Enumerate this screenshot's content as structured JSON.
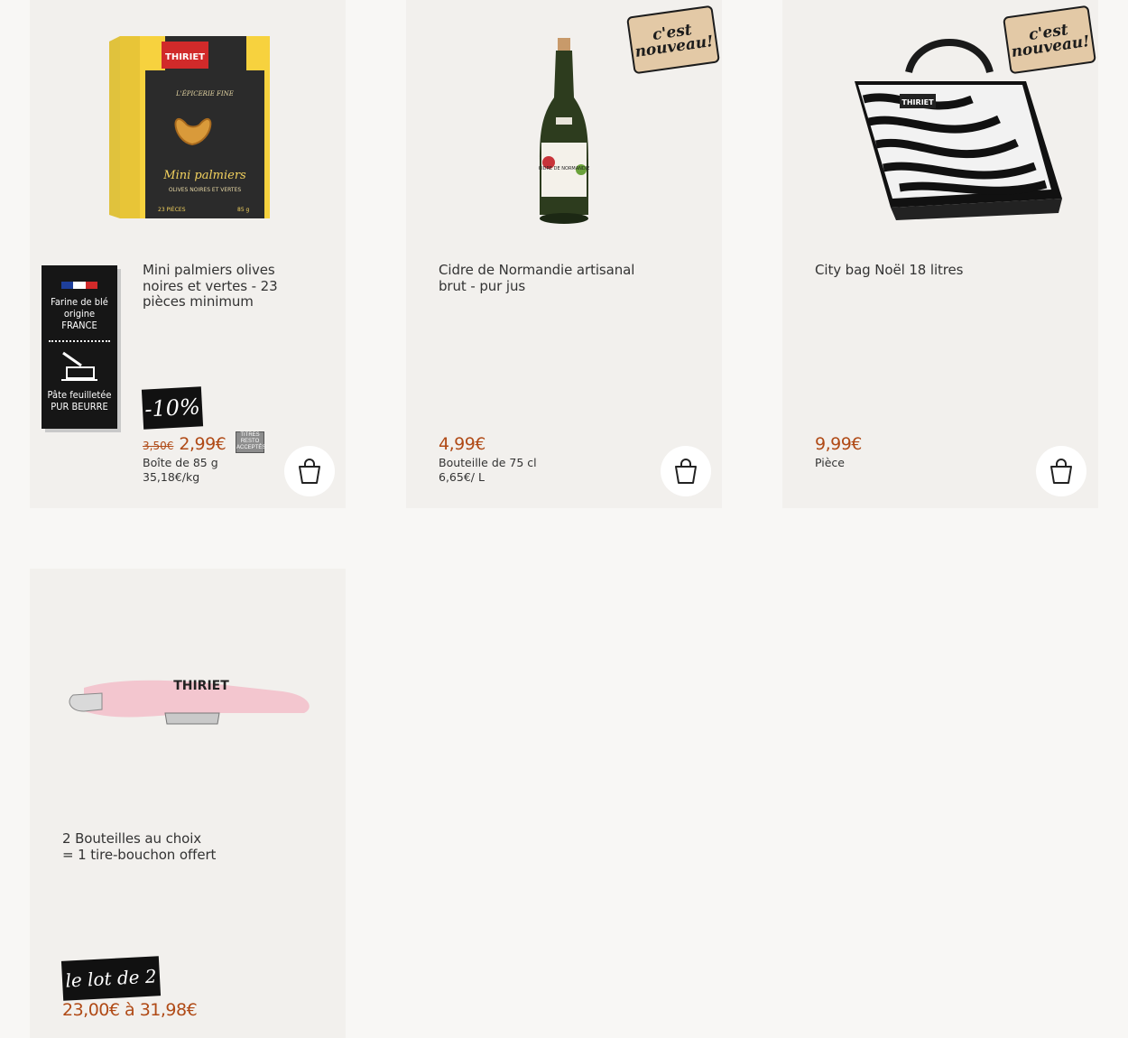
{
  "products": [
    {
      "title": "Mini palmiers olives noires et vertes - 23 pièces minimum",
      "discount": "-10%",
      "old_price": "3,50€",
      "price": "2,99€",
      "unit_line1": "Boîte de 85 g",
      "unit_line2": "35,18€/kg",
      "resto_badge": "TITRES RESTO ACCEPTÉS",
      "flour_label": {
        "line1": "Farine de blé",
        "line2": "origine",
        "line3": "FRANCE",
        "line4": "Pâte feuilletée",
        "line5": "PUR BEURRE"
      },
      "pack": {
        "brand": "THIRIET",
        "subtitle": "L'ÉPICERIE FINE",
        "name": "Mini palmiers",
        "sub": "OLIVES NOIRES ET VERTES",
        "count": "23 PIÈCES",
        "weight": "85 g"
      }
    },
    {
      "title": "Cidre de Normandie artisanal brut - pur jus",
      "badge_line1": "c'est",
      "badge_line2": "nouveau!",
      "price": "4,99€",
      "unit_line1": "Bouteille de 75 cl",
      "unit_line2": "6,65€/ L",
      "bottle_label": "CIDRE DE NORMANDIE"
    },
    {
      "title": "City bag Noël 18 litres",
      "badge_line1": "c'est",
      "badge_line2": "nouveau!",
      "price": "9,99€",
      "unit_line1": "Pièce",
      "bag_brand": "THIRIET"
    },
    {
      "title_line1": "2 Bouteilles au choix",
      "title_line2": "= 1 tire-bouchon offert",
      "tag": "le lot de 2",
      "price": "23,00€ à 31,98€",
      "corkscrew_brand": "THIRIET"
    }
  ],
  "colors": {
    "page_bg": "#f8f7f5",
    "card_bg": "#f2f0ed",
    "price": "#b04a16"
  },
  "icons": {
    "cart": "shopping-bag-icon"
  }
}
